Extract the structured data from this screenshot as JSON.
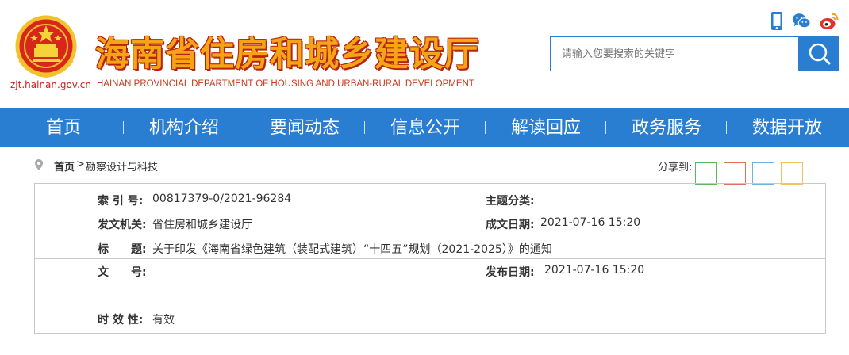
{
  "header": {
    "domain": "zjt.hainan.gov.cn",
    "title": "海南省住房和城乡建设厅",
    "subtitle": "HAINAN PROVINCIAL DEPARTMENT OF HOUSING AND URBAN-RURAL DEVELOPMENT",
    "icons": [
      "mobile-icon",
      "wechat-icon",
      "weibo-icon"
    ]
  },
  "search": {
    "placeholder": "请输入您要搜索的关键字",
    "value": ""
  },
  "nav": {
    "items": [
      "首页",
      "机构介绍",
      "要闻动态",
      "信息公开",
      "解读回应",
      "政务服务",
      "数据开放"
    ]
  },
  "breadcrumb": {
    "home": "首页",
    "separator": ">",
    "current": "勘察设计与科技"
  },
  "share": {
    "label": "分享到:",
    "colors": [
      "#5cb85c",
      "#e0715c",
      "#6cb3e0",
      "#f0c45a"
    ]
  },
  "info": {
    "index_label": "索 引 号:",
    "index_value": "00817379-0/2021-96284",
    "topic_label": "主题分类:",
    "topic_value": "",
    "issuer_label": "发文机关:",
    "issuer_value": "省住房和城乡建设厅",
    "created_label": "成文日期:",
    "created_value": "2021-07-16 15:20",
    "title_label": "标　　题:",
    "title_value": "关于印发《海南省绿色建筑（装配式建筑）“十四五”规划（2021-2025）》的通知",
    "docno_label": "文　　号:",
    "docno_value": "",
    "published_label": "发布日期:",
    "published_value": "2021-07-16 15:20",
    "validity_label": "时 效 性:",
    "validity_value": "有效"
  },
  "colors": {
    "brand_blue": "#2a7ed2",
    "title_gold": "#f3a516",
    "title_red": "#b6230f"
  }
}
